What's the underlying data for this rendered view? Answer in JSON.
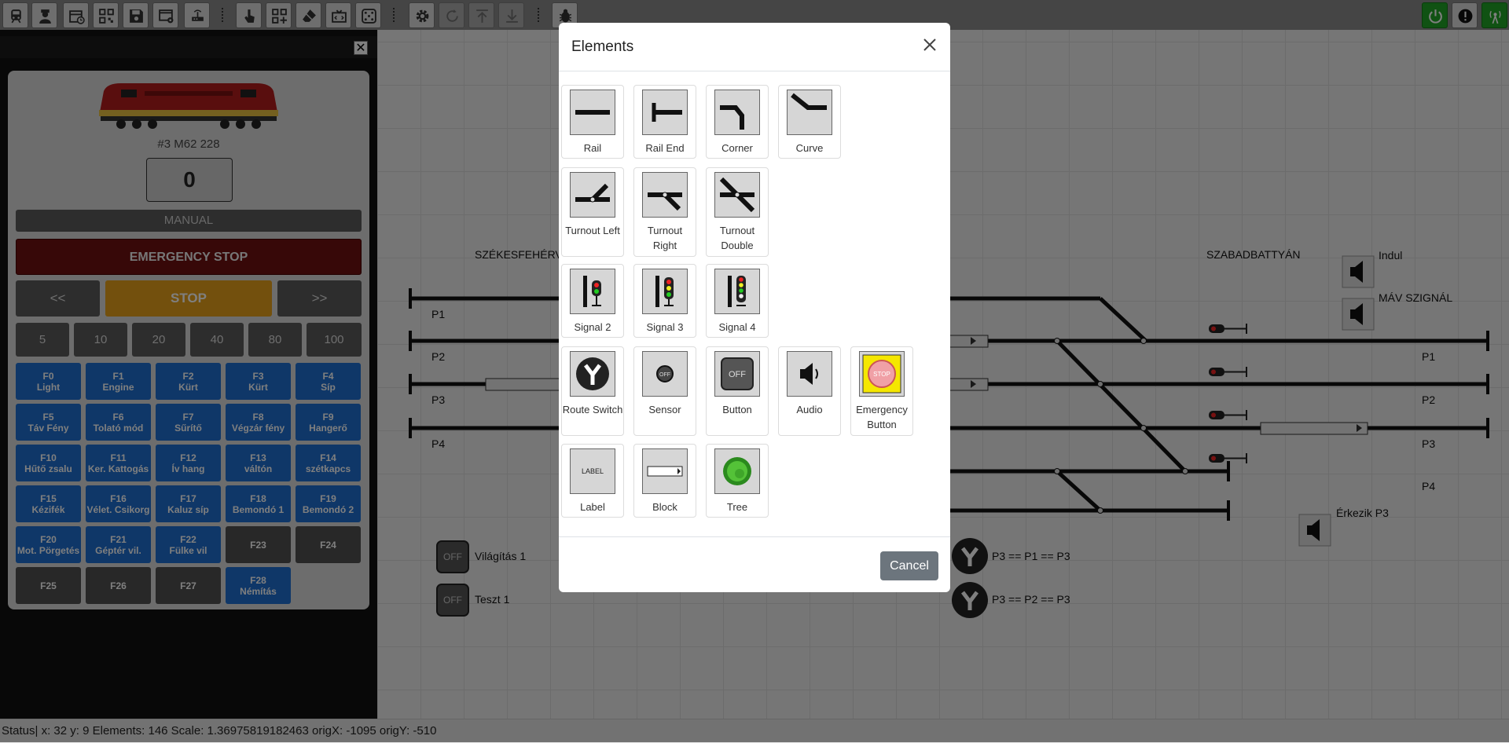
{
  "toolbar": {
    "left_icons": [
      "train-icon",
      "engineer-icon",
      "timetable-icon",
      "qr-icon",
      "save-icon",
      "window-settings-icon",
      "router-icon",
      "pointer-icon",
      "add-element-icon",
      "eraser-icon",
      "code-icon",
      "dice-icon",
      "gear-icon",
      "refresh-icon",
      "upload-icon",
      "download-icon",
      "bug-icon"
    ],
    "right_icons": [
      "power-icon",
      "alert-icon",
      "antenna-icon"
    ],
    "accent_color": "#21a526"
  },
  "left_panel": {
    "loco_name": "#3 M62 228",
    "speed": "0",
    "mode": "MANUAL",
    "emergency_label": "EMERGENCY STOP",
    "reverse_label": "<<",
    "stop_label": "STOP",
    "forward_label": ">>",
    "speed_steps": [
      "5",
      "10",
      "20",
      "40",
      "80",
      "100"
    ],
    "functions": [
      {
        "key": "F0",
        "name": "Light",
        "active": true
      },
      {
        "key": "F1",
        "name": "Engine",
        "active": true
      },
      {
        "key": "F2",
        "name": "Kürt",
        "active": true
      },
      {
        "key": "F3",
        "name": "Kürt",
        "active": true
      },
      {
        "key": "F4",
        "name": "Síp",
        "active": true
      },
      {
        "key": "F5",
        "name": "Táv Fény",
        "active": true
      },
      {
        "key": "F6",
        "name": "Tolató mód",
        "active": true
      },
      {
        "key": "F7",
        "name": "Sűrítő",
        "active": true
      },
      {
        "key": "F8",
        "name": "Végzár fény",
        "active": true
      },
      {
        "key": "F9",
        "name": "Hangerő",
        "active": true
      },
      {
        "key": "F10",
        "name": "Hűtő zsalu",
        "active": true
      },
      {
        "key": "F11",
        "name": "Ker. Kattogás",
        "active": true
      },
      {
        "key": "F12",
        "name": "Ív hang",
        "active": true
      },
      {
        "key": "F13",
        "name": "váltón",
        "active": true
      },
      {
        "key": "F14",
        "name": "szétkapcs",
        "active": true
      },
      {
        "key": "F15",
        "name": "Kézifék",
        "active": true
      },
      {
        "key": "F16",
        "name": "Vélet. Csikorg",
        "active": true
      },
      {
        "key": "F17",
        "name": "Kaluz síp",
        "active": true
      },
      {
        "key": "F18",
        "name": "Bemondó 1",
        "active": true
      },
      {
        "key": "F19",
        "name": "Bemondó 2",
        "active": true
      },
      {
        "key": "F20",
        "name": "Mot. Pörgetés",
        "active": true
      },
      {
        "key": "F21",
        "name": "Géptér vil.",
        "active": true
      },
      {
        "key": "F22",
        "name": "Fülke vil",
        "active": true
      },
      {
        "key": "F23",
        "name": "",
        "active": false
      },
      {
        "key": "F24",
        "name": "",
        "active": false
      },
      {
        "key": "F25",
        "name": "",
        "active": false
      },
      {
        "key": "F26",
        "name": "",
        "active": false
      },
      {
        "key": "F27",
        "name": "",
        "active": false
      },
      {
        "key": "F28",
        "name": "Némítás",
        "active": true
      }
    ]
  },
  "layout": {
    "station_left": "SZÉKESFEHÉRV",
    "station_right": "SZABADBATTYÁN",
    "left_tracks": [
      "P1",
      "P2",
      "P3",
      "P4"
    ],
    "right_tracks": [
      "P1",
      "P2",
      "P3",
      "P4"
    ],
    "audio": [
      "Indul",
      "MÁV SZIGNÁL",
      "Érkezik P3"
    ],
    "buttons": [
      {
        "state": "OFF",
        "label": "Világítás 1"
      },
      {
        "state": "OFF",
        "label": "Teszt 1"
      }
    ],
    "routes": [
      "P3 == P1 == P3",
      "P3 == P2 == P3"
    ]
  },
  "modal": {
    "title": "Elements",
    "cancel_label": "Cancel",
    "elements": [
      {
        "label": "Rail",
        "icon": "rail-icon"
      },
      {
        "label": "Rail End",
        "icon": "rail-end-icon"
      },
      {
        "label": "Corner",
        "icon": "corner-icon"
      },
      {
        "label": "Curve",
        "icon": "curve-icon"
      },
      {
        "label": "Turnout Left",
        "icon": "turnout-left-icon"
      },
      {
        "label": "Turnout Right",
        "icon": "turnout-right-icon"
      },
      {
        "label": "Turnout Double",
        "icon": "turnout-double-icon"
      },
      {
        "label": "Signal 2",
        "icon": "signal-2-icon"
      },
      {
        "label": "Signal 3",
        "icon": "signal-3-icon"
      },
      {
        "label": "Signal 4",
        "icon": "signal-4-icon"
      },
      {
        "label": "Route Switch",
        "icon": "route-switch-icon"
      },
      {
        "label": "Sensor",
        "icon": "sensor-icon",
        "icon_text": "OFF"
      },
      {
        "label": "Button",
        "icon": "button-icon",
        "icon_text": "OFF"
      },
      {
        "label": "Audio",
        "icon": "audio-icon"
      },
      {
        "label": "Emergency Button",
        "icon": "emergency-button-icon",
        "icon_text": "STOP"
      },
      {
        "label": "Label",
        "icon": "label-icon",
        "icon_text": "LABEL"
      },
      {
        "label": "Block",
        "icon": "block-icon"
      },
      {
        "label": "Tree",
        "icon": "tree-icon"
      }
    ]
  },
  "status": {
    "text": "Status| x: 32 y: 9 Elements: 146 Scale: 1.36975819182463 origX: -1095 origY: -510"
  }
}
